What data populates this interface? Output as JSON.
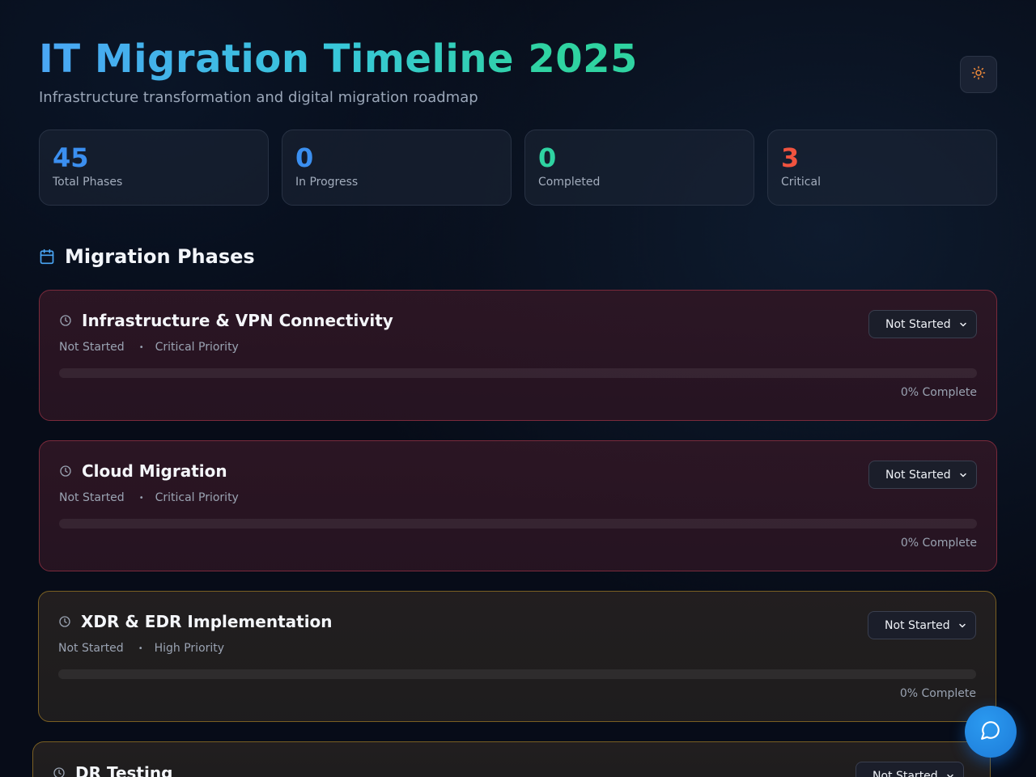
{
  "header": {
    "title": "IT Migration Timeline 2025",
    "subtitle": "Infrastructure transformation and digital migration roadmap",
    "theme_toggle_icon": "sun-icon"
  },
  "stats": [
    {
      "value": "45",
      "label": "Total Phases",
      "color": "#3b8ff0"
    },
    {
      "value": "0",
      "label": "In Progress",
      "color": "#3b8ff0"
    },
    {
      "value": "0",
      "label": "Completed",
      "color": "#2fd3a1"
    },
    {
      "value": "3",
      "label": "Critical",
      "color": "#f0533f"
    }
  ],
  "section": {
    "icon": "calendar-icon",
    "title": "Migration Phases"
  },
  "phases": [
    {
      "title": "Infrastructure & VPN Connectivity",
      "status": "Not Started",
      "priority": "Critical Priority",
      "select_value": "Not Started",
      "progress": 0,
      "progress_label": "0% Complete"
    },
    {
      "title": "Cloud Migration",
      "status": "Not Started",
      "priority": "Critical Priority",
      "select_value": "Not Started",
      "progress": 0,
      "progress_label": "0% Complete"
    },
    {
      "title": "XDR & EDR Implementation",
      "status": "Not Started",
      "priority": "High Priority",
      "select_value": "Not Started",
      "progress": 0,
      "progress_label": "0% Complete"
    },
    {
      "title": "DR Testing",
      "select_value": "Not Started"
    }
  ],
  "colors": {
    "critical_border": "#7a2a3b",
    "high_border": "#7a5f22",
    "accent": "#3b8ff0"
  },
  "chat_button_icon": "chat-icon",
  "dot_separator": "•"
}
